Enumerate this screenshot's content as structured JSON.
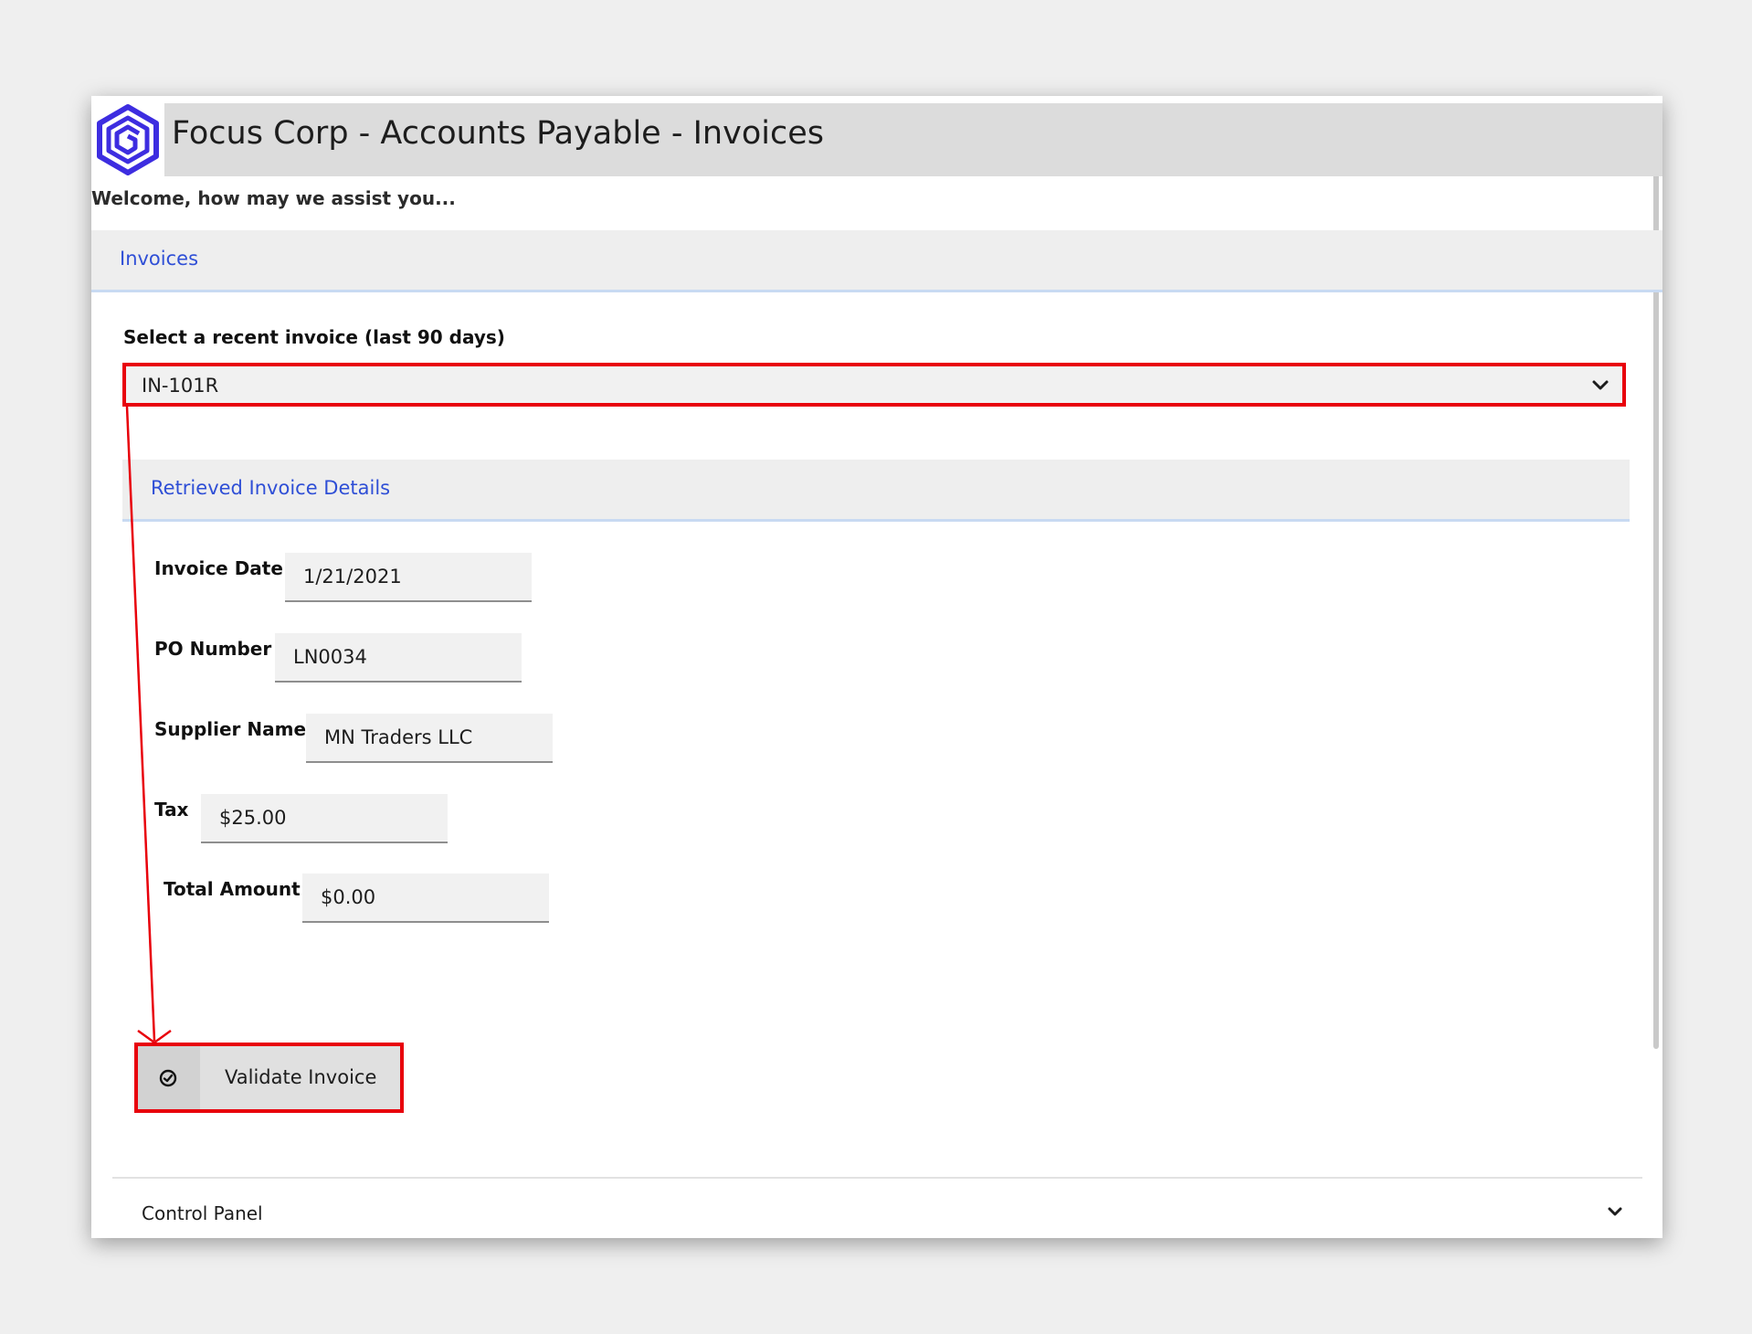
{
  "header": {
    "title": "Focus Corp - Accounts Payable - Invoices",
    "logo_icon": "hexagon-logo-icon",
    "brand_color": "#3d2de0"
  },
  "welcome": "Welcome, how may we assist you...",
  "tabs": [
    {
      "label": "Invoices"
    }
  ],
  "invoice_select": {
    "label": "Select a recent invoice (last 90 days)",
    "value": "IN-101R"
  },
  "details": {
    "title": "Retrieved Invoice Details",
    "fields": [
      {
        "label": "Invoice Date",
        "value": "1/21/2021"
      },
      {
        "label": "PO Number",
        "value": "LN0034"
      },
      {
        "label": "Supplier Name",
        "value": "MN Traders LLC"
      },
      {
        "label": "Tax",
        "value": "$25.00"
      },
      {
        "label": "Total Amount",
        "value": "$0.00"
      }
    ]
  },
  "validate_button": {
    "label": "Validate Invoice",
    "icon": "check-circle-icon"
  },
  "control_panel": {
    "label": "Control Panel"
  },
  "colors": {
    "accent_link": "#2f4fd6",
    "annotation": "#e8000b"
  }
}
